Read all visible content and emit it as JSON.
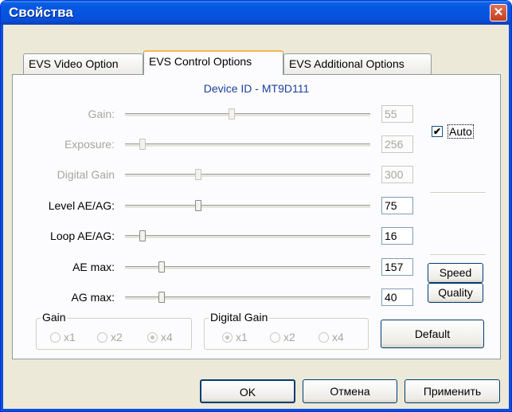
{
  "window": {
    "title": "Свойства",
    "close_glyph": "✕"
  },
  "tabs": [
    {
      "label": "EVS Video Option",
      "active": false
    },
    {
      "label": "EVS Control Options",
      "active": true
    },
    {
      "label": "EVS Additional Options",
      "active": false
    }
  ],
  "panel": {
    "device_id": "Device ID - MT9D111",
    "rows": [
      {
        "label": "Gain:",
        "value": "55",
        "enabled": false,
        "position": 0.435
      },
      {
        "label": "Exposure:",
        "value": "256",
        "enabled": false,
        "position": 0.07
      },
      {
        "label": "Digital Gain",
        "value": "300",
        "enabled": false,
        "position": 0.3
      },
      {
        "label": "Level AE/AG:",
        "value": "75",
        "enabled": true,
        "position": 0.3
      },
      {
        "label": "Loop AE/AG:",
        "value": "16",
        "enabled": true,
        "position": 0.07
      },
      {
        "label": "AE max:",
        "value": "157",
        "enabled": true,
        "position": 0.15
      },
      {
        "label": "AG max:",
        "value": "40",
        "enabled": true,
        "position": 0.15
      }
    ],
    "auto": {
      "label": "Auto",
      "checked": true,
      "check_glyph": "✔"
    },
    "speed_button": "Speed",
    "quality_button": "Quality",
    "default_button": "Default",
    "gain_group": {
      "title": "Gain",
      "options": [
        "x1",
        "x2",
        "x4"
      ],
      "selected": 2
    },
    "digital_gain_group": {
      "title": "Digital Gain",
      "options": [
        "x1",
        "x2",
        "x4"
      ],
      "selected": 0
    }
  },
  "footer": {
    "ok": "OK",
    "cancel": "Отмена",
    "apply": "Применить"
  }
}
